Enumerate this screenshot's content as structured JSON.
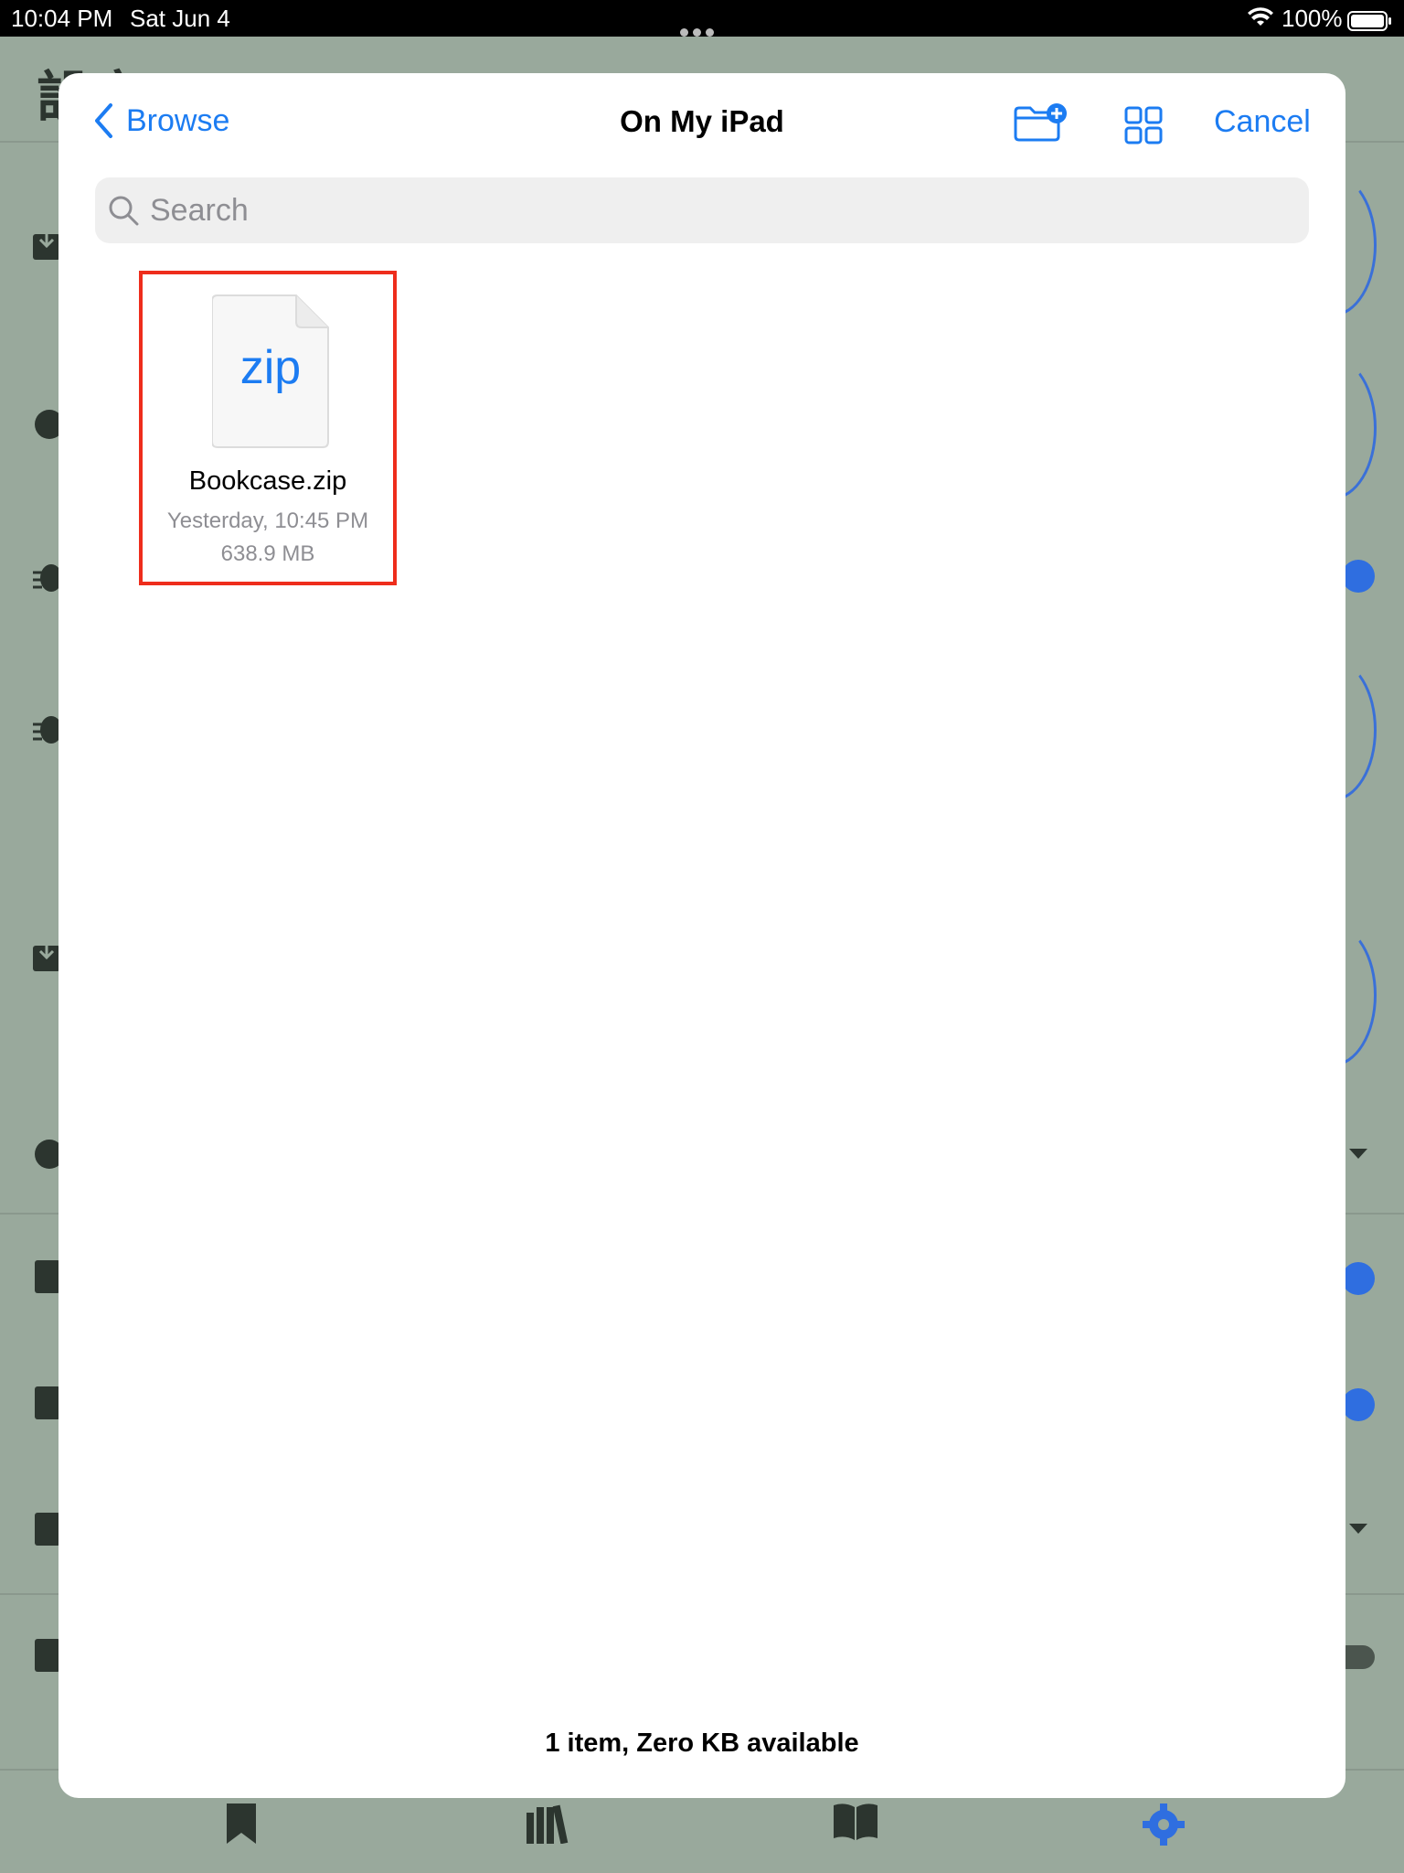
{
  "status_bar": {
    "time": "10:04 PM",
    "date": "Sat Jun 4",
    "battery_percent": "100%"
  },
  "background_app": {
    "title": "設定"
  },
  "picker": {
    "back_label": "Browse",
    "title": "On My iPad",
    "cancel_label": "Cancel",
    "search_placeholder": "Search",
    "accent_color": "#1c7cf2",
    "files": [
      {
        "ext": "zip",
        "name": "Bookcase.zip",
        "date": "Yesterday, 10:45 PM",
        "size": "638.9 MB",
        "selected": true
      }
    ],
    "footer": "1 item, Zero KB available"
  }
}
